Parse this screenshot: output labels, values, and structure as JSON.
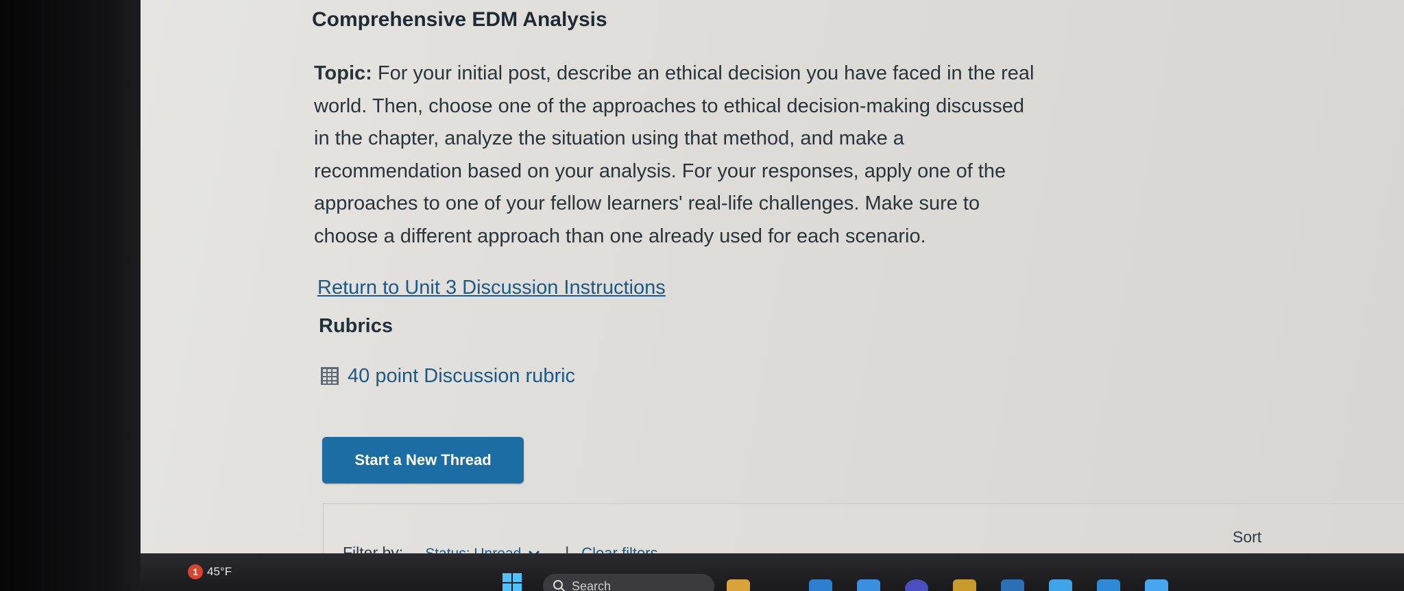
{
  "page": {
    "title": "Comprehensive EDM Analysis",
    "topic_label": "Topic:",
    "topic_lines": [
      "For your initial post, describe an ethical decision you have faced in the real",
      "world. Then, choose one of the approaches to ethical decision-making discussed",
      "in the chapter, analyze the situation using that method, and make a",
      "recommendation based on your analysis. For your responses, apply one of the",
      "approaches to one of your fellow learners' real-life challenges. Make sure to",
      "choose a different approach than one already used for each scenario."
    ],
    "return_link": "Return to Unit 3 Discussion Instructions",
    "rubrics_heading": "Rubrics",
    "rubric_link": "40 point Discussion rubric",
    "new_thread_button": "Start a New Thread"
  },
  "filters": {
    "label": "Filter by:",
    "status": "Status: Unread",
    "separator": "|",
    "clear": "Clear filters",
    "sort_label": "Sort"
  },
  "taskbar": {
    "notification_count": "1",
    "temperature": "45°F",
    "search_text": "Search"
  },
  "colors": {
    "link": "#1b5a86",
    "button": "#1c6da3",
    "badge": "#d6452f"
  }
}
